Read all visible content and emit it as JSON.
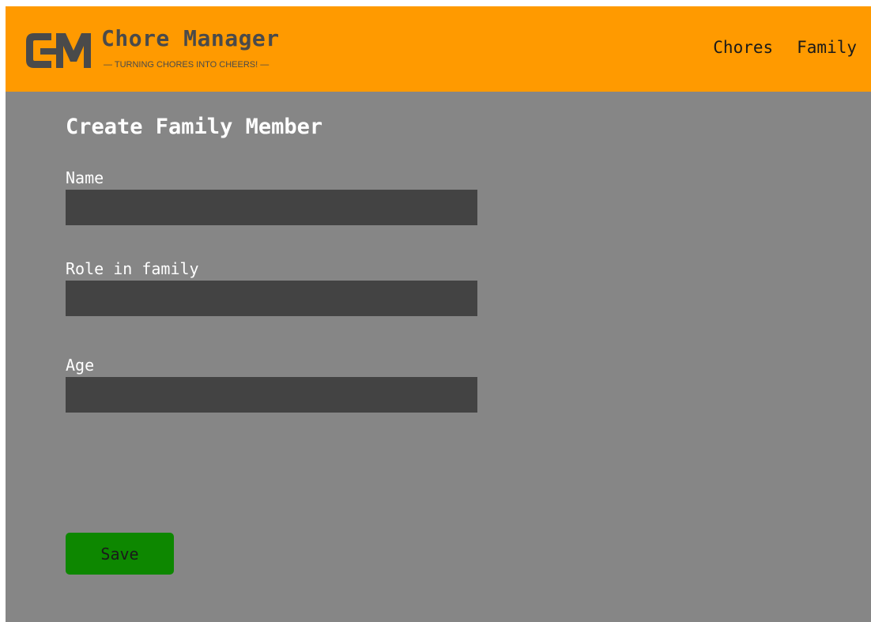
{
  "header": {
    "brand_title": "Chore Manager",
    "brand_tagline": "— TURNING CHORES INTO CHEERS! —",
    "logo_icon": "cm-logo-icon",
    "background_color": "#ff9a00",
    "nav": {
      "chores": "Chores",
      "family": "Family"
    }
  },
  "main": {
    "title": "Create Family Member",
    "fields": {
      "name": {
        "label": "Name",
        "value": ""
      },
      "role": {
        "label": "Role in family",
        "value": ""
      },
      "age": {
        "label": "Age",
        "value": ""
      }
    },
    "save_label": "Save",
    "save_color": "#0d8700"
  }
}
